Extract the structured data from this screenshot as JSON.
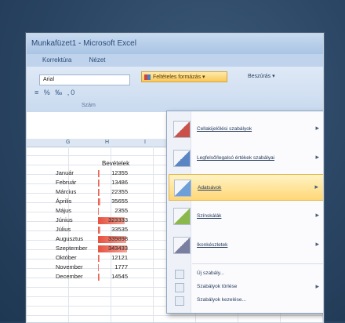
{
  "window": {
    "title": "Munkafüzet1 - Microsoft Excel"
  },
  "tabs": [
    "Korrektúra",
    "Nézet"
  ],
  "ribbon": {
    "font_name": "Arial",
    "number_group_label": "Szám",
    "conditional_formatting_label": "Feltételes formázás",
    "insert_label": "Beszúrás"
  },
  "sheet": {
    "column_headers": [
      "G",
      "H",
      "I"
    ],
    "header_cell": "Bevételek",
    "rows": [
      {
        "month": "Január",
        "value": "12355",
        "fill": 0.05
      },
      {
        "month": "Február",
        "value": "13486",
        "fill": 0.05
      },
      {
        "month": "Március",
        "value": "22355",
        "fill": 0.06
      },
      {
        "month": "Április",
        "value": "35655",
        "fill": 0.08
      },
      {
        "month": "Május",
        "value": "2355",
        "fill": 0.03
      },
      {
        "month": "Június",
        "value": "323333",
        "fill": 0.85
      },
      {
        "month": "Július",
        "value": "33535",
        "fill": 0.08
      },
      {
        "month": "Augusztus",
        "value": "339898",
        "fill": 0.9
      },
      {
        "month": "Szeptember",
        "value": "343433",
        "fill": 0.92
      },
      {
        "month": "Október",
        "value": "12121",
        "fill": 0.05
      },
      {
        "month": "November",
        "value": "1777",
        "fill": 0.03
      },
      {
        "month": "December",
        "value": "14545",
        "fill": 0.05
      }
    ]
  },
  "menu": {
    "items": [
      {
        "label": "Cellakijelölési szabályok",
        "icon": "highlight-cells-icon",
        "highlighted": false
      },
      {
        "label": "Legfelső/legalsó értékek szabályai",
        "icon": "top-bottom-icon",
        "highlighted": false
      },
      {
        "label": "Adatsávok",
        "icon": "data-bars-icon",
        "highlighted": true
      },
      {
        "label": "Színskálák",
        "icon": "color-scales-icon",
        "highlighted": false
      },
      {
        "label": "Ikonkészletek",
        "icon": "icon-sets-icon",
        "highlighted": false
      }
    ],
    "small_items": [
      {
        "label": "Új szabály...",
        "has_arrow": false
      },
      {
        "label": "Szabályok törlése",
        "has_arrow": true
      },
      {
        "label": "Szabályok kezelése...",
        "has_arrow": false
      }
    ]
  },
  "colors": {
    "highlight": "#ffd777",
    "bar": "#e4513f",
    "background": "#2a4563"
  }
}
